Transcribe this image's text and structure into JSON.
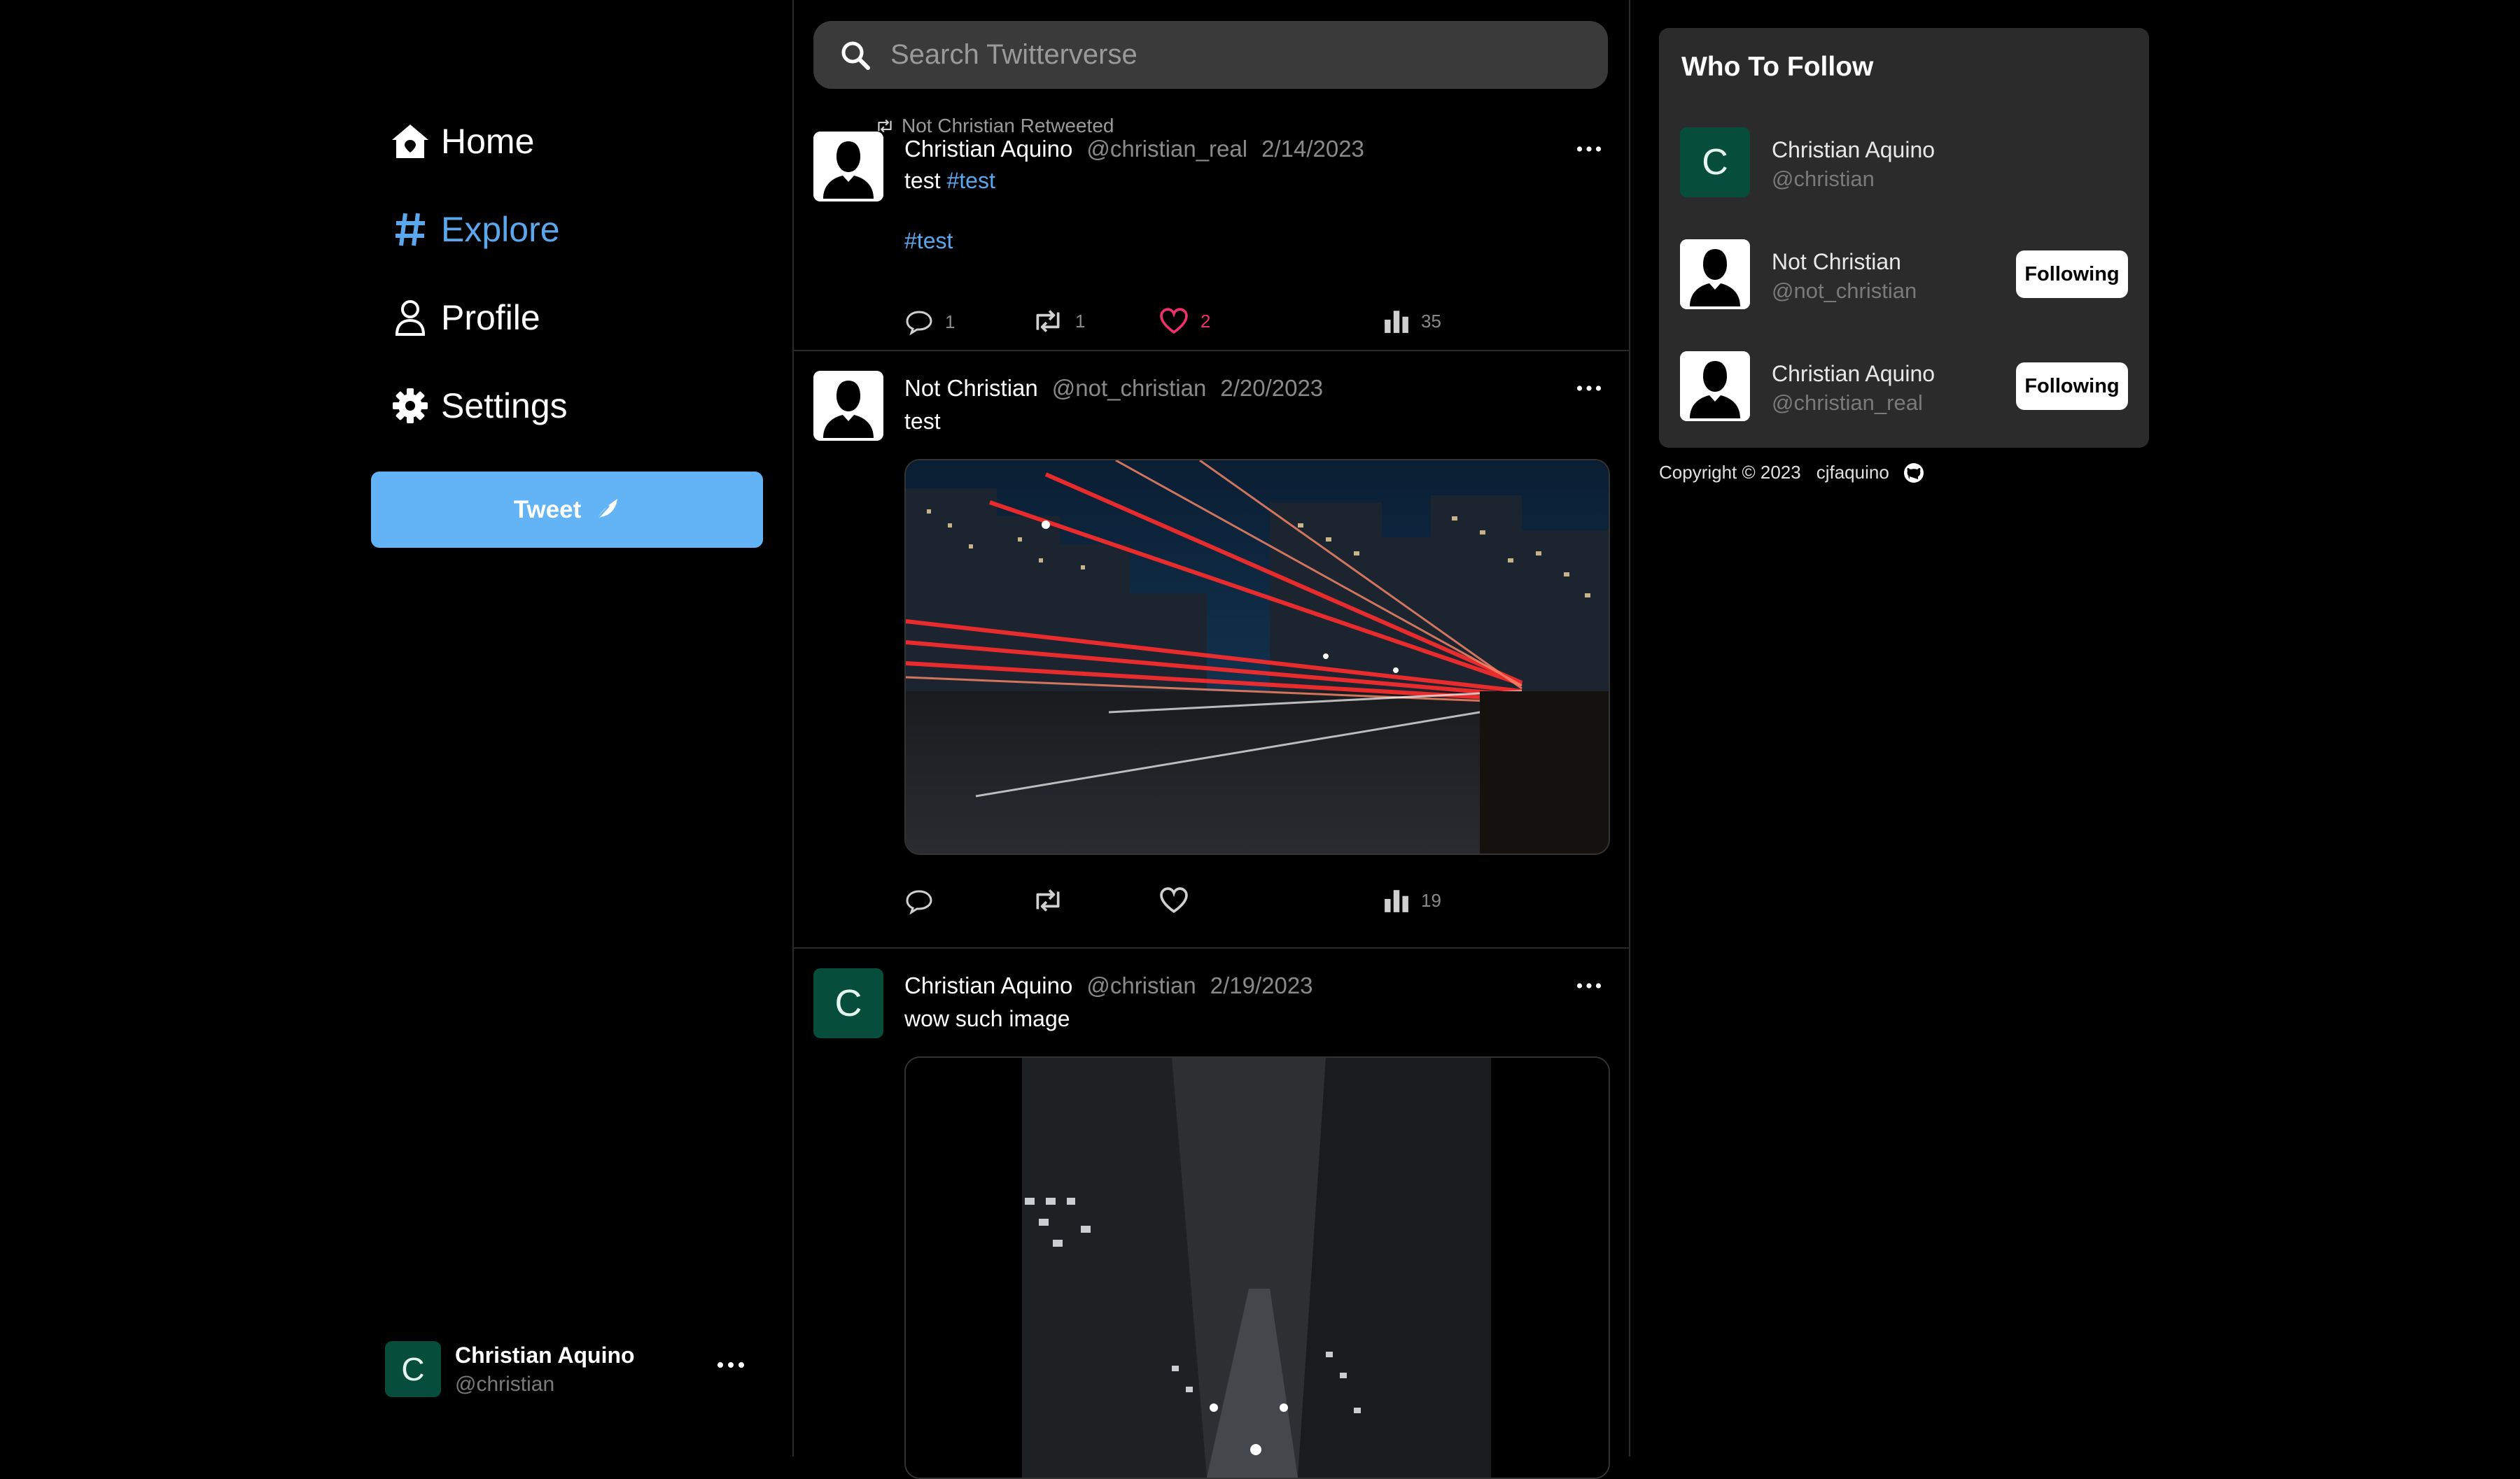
{
  "nav": {
    "items": [
      {
        "label": "Home",
        "icon": "home-icon"
      },
      {
        "label": "Explore",
        "icon": "hashtag-icon",
        "active": true
      },
      {
        "label": "Profile",
        "icon": "user-icon"
      },
      {
        "label": "Settings",
        "icon": "gear-icon"
      }
    ],
    "tweet_button": "Tweet"
  },
  "current_user": {
    "name": "Christian Aquino",
    "handle": "@christian",
    "avatar_letter": "C"
  },
  "search": {
    "placeholder": "Search Twitterverse",
    "value": ""
  },
  "feed": [
    {
      "retweeted_by": "Not Christian Retweeted",
      "name": "Christian Aquino",
      "handle": "@christian_real",
      "date": "2/14/2023",
      "text": "test",
      "hashtag": "#test",
      "extra_hashtag": "#test",
      "avatar": "silhouette",
      "stats": {
        "replies": "1",
        "retweets": "1",
        "likes": "2",
        "views": "35"
      }
    },
    {
      "name": "Not Christian",
      "handle": "@not_christian",
      "date": "2/20/2023",
      "text": "test",
      "avatar": "silhouette",
      "image": "city-night-light-trails",
      "stats": {
        "views": "19"
      }
    },
    {
      "name": "Christian Aquino",
      "handle": "@christian",
      "date": "2/19/2023",
      "text": "wow such image",
      "avatar_letter": "C",
      "image": "city-street-night-buildings"
    }
  ],
  "who_to_follow": {
    "title": "Who To Follow",
    "users": [
      {
        "name": "Christian Aquino",
        "handle": "@christian",
        "avatar_letter": "C"
      },
      {
        "name": "Not Christian",
        "handle": "@not_christian",
        "button": "Following"
      },
      {
        "name": "Christian Aquino",
        "handle": "@christian_real",
        "button": "Following"
      }
    ]
  },
  "footer": {
    "copyright": "Copyright © 2023",
    "author": "cjfaquino"
  },
  "colors": {
    "accent": "#5aa7ee",
    "tweet_button": "#63b3f7",
    "like": "#f0306a",
    "avatar_green": "#064e3b"
  }
}
